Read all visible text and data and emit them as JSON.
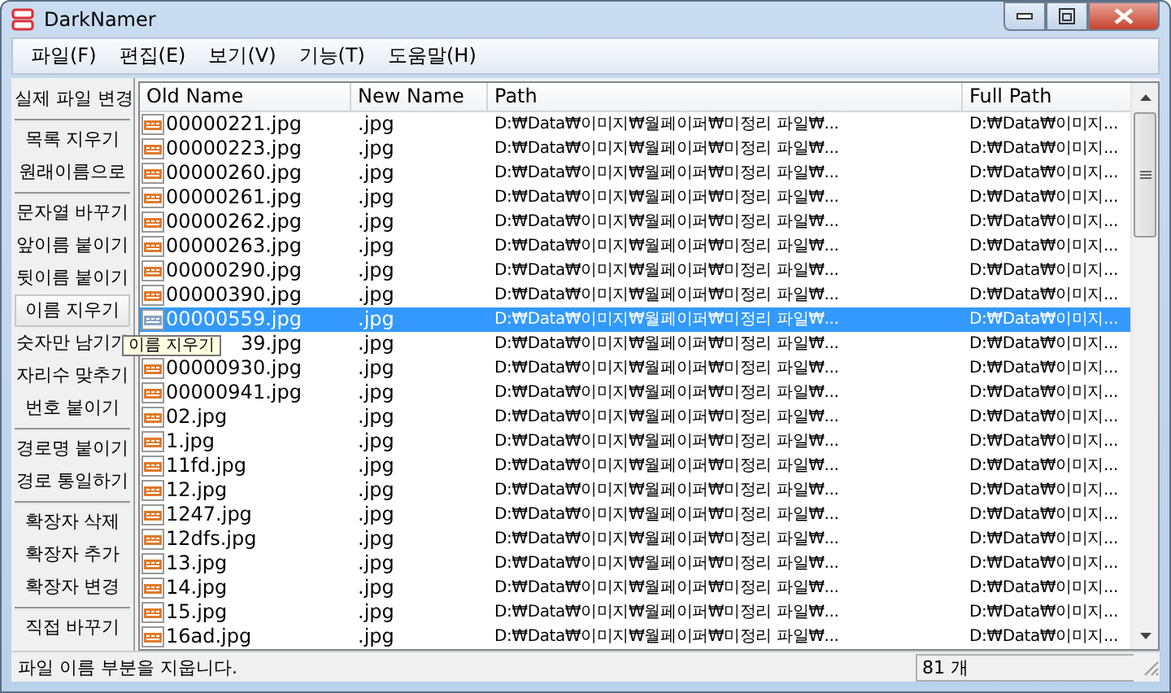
{
  "window": {
    "title": "DarkNamer"
  },
  "menu": [
    "파일(F)",
    "편집(E)",
    "보기(V)",
    "기능(T)",
    "도움말(H)"
  ],
  "sidebar": {
    "groups": [
      {
        "buttons": [
          {
            "label": "실제 파일 변경",
            "hovered": false
          }
        ]
      },
      {
        "buttons": [
          {
            "label": "목록 지우기",
            "hovered": false
          },
          {
            "label": "원래이름으로",
            "hovered": false
          }
        ]
      },
      {
        "buttons": [
          {
            "label": "문자열 바꾸기",
            "hovered": false
          },
          {
            "label": "앞이름 붙이기",
            "hovered": false
          },
          {
            "label": "뒷이름 붙이기",
            "hovered": false
          },
          {
            "label": "이름 지우기",
            "hovered": true
          },
          {
            "label": "숫자만 남기기",
            "hovered": false
          },
          {
            "label": "자리수 맞추기",
            "hovered": false
          },
          {
            "label": "번호 붙이기",
            "hovered": false
          }
        ]
      },
      {
        "buttons": [
          {
            "label": "경로명 붙이기",
            "hovered": false
          },
          {
            "label": "경로 통일하기",
            "hovered": false
          }
        ]
      },
      {
        "buttons": [
          {
            "label": "확장자 삭제",
            "hovered": false
          },
          {
            "label": "확장자 추가",
            "hovered": false
          },
          {
            "label": "확장자 변경",
            "hovered": false
          }
        ]
      },
      {
        "buttons": [
          {
            "label": "직접 바꾸기",
            "hovered": false
          }
        ]
      }
    ]
  },
  "table": {
    "columns": [
      "Old Name",
      "New Name",
      "Path",
      "Full Path"
    ],
    "rows": [
      {
        "old_name": "00000221.jpg",
        "new_name": ".jpg",
        "path": "D:₩Data₩이미지₩월페이퍼₩미정리 파일₩...",
        "full_path": "D:₩Data₩이미지...",
        "selected": false
      },
      {
        "old_name": "00000223.jpg",
        "new_name": ".jpg",
        "path": "D:₩Data₩이미지₩월페이퍼₩미정리 파일₩...",
        "full_path": "D:₩Data₩이미지...",
        "selected": false
      },
      {
        "old_name": "00000260.jpg",
        "new_name": ".jpg",
        "path": "D:₩Data₩이미지₩월페이퍼₩미정리 파일₩...",
        "full_path": "D:₩Data₩이미지...",
        "selected": false
      },
      {
        "old_name": "00000261.jpg",
        "new_name": ".jpg",
        "path": "D:₩Data₩이미지₩월페이퍼₩미정리 파일₩...",
        "full_path": "D:₩Data₩이미지...",
        "selected": false
      },
      {
        "old_name": "00000262.jpg",
        "new_name": ".jpg",
        "path": "D:₩Data₩이미지₩월페이퍼₩미정리 파일₩...",
        "full_path": "D:₩Data₩이미지...",
        "selected": false
      },
      {
        "old_name": "00000263.jpg",
        "new_name": ".jpg",
        "path": "D:₩Data₩이미지₩월페이퍼₩미정리 파일₩...",
        "full_path": "D:₩Data₩이미지...",
        "selected": false
      },
      {
        "old_name": "00000290.jpg",
        "new_name": ".jpg",
        "path": "D:₩Data₩이미지₩월페이퍼₩미정리 파일₩...",
        "full_path": "D:₩Data₩이미지...",
        "selected": false
      },
      {
        "old_name": "00000390.jpg",
        "new_name": ".jpg",
        "path": "D:₩Data₩이미지₩월페이퍼₩미정리 파일₩...",
        "full_path": "D:₩Data₩이미지...",
        "selected": false
      },
      {
        "old_name": "00000559.jpg",
        "new_name": ".jpg",
        "path": "D:₩Data₩이미지₩월페이퍼₩미정리 파일₩...",
        "full_path": "D:₩Data₩이미지...",
        "selected": true
      },
      {
        "old_name": "39.jpg",
        "new_name": ".jpg",
        "path": "D:₩Data₩이미지₩월페이퍼₩미정리 파일₩...",
        "full_path": "D:₩Data₩이미지...",
        "selected": false,
        "covered": true
      },
      {
        "old_name": "00000930.jpg",
        "new_name": ".jpg",
        "path": "D:₩Data₩이미지₩월페이퍼₩미정리 파일₩...",
        "full_path": "D:₩Data₩이미지...",
        "selected": false
      },
      {
        "old_name": "00000941.jpg",
        "new_name": ".jpg",
        "path": "D:₩Data₩이미지₩월페이퍼₩미정리 파일₩...",
        "full_path": "D:₩Data₩이미지...",
        "selected": false
      },
      {
        "old_name": "02.jpg",
        "new_name": ".jpg",
        "path": "D:₩Data₩이미지₩월페이퍼₩미정리 파일₩...",
        "full_path": "D:₩Data₩이미지...",
        "selected": false
      },
      {
        "old_name": "1.jpg",
        "new_name": ".jpg",
        "path": "D:₩Data₩이미지₩월페이퍼₩미정리 파일₩...",
        "full_path": "D:₩Data₩이미지...",
        "selected": false
      },
      {
        "old_name": "11fd.jpg",
        "new_name": ".jpg",
        "path": "D:₩Data₩이미지₩월페이퍼₩미정리 파일₩...",
        "full_path": "D:₩Data₩이미지...",
        "selected": false
      },
      {
        "old_name": "12.jpg",
        "new_name": ".jpg",
        "path": "D:₩Data₩이미지₩월페이퍼₩미정리 파일₩...",
        "full_path": "D:₩Data₩이미지...",
        "selected": false
      },
      {
        "old_name": "1247.jpg",
        "new_name": ".jpg",
        "path": "D:₩Data₩이미지₩월페이퍼₩미정리 파일₩...",
        "full_path": "D:₩Data₩이미지...",
        "selected": false
      },
      {
        "old_name": "12dfs.jpg",
        "new_name": ".jpg",
        "path": "D:₩Data₩이미지₩월페이퍼₩미정리 파일₩...",
        "full_path": "D:₩Data₩이미지...",
        "selected": false
      },
      {
        "old_name": "13.jpg",
        "new_name": ".jpg",
        "path": "D:₩Data₩이미지₩월페이퍼₩미정리 파일₩...",
        "full_path": "D:₩Data₩이미지...",
        "selected": false
      },
      {
        "old_name": "14.jpg",
        "new_name": ".jpg",
        "path": "D:₩Data₩이미지₩월페이퍼₩미정리 파일₩...",
        "full_path": "D:₩Data₩이미지...",
        "selected": false
      },
      {
        "old_name": "15.jpg",
        "new_name": ".jpg",
        "path": "D:₩Data₩이미지₩월페이퍼₩미정리 파일₩...",
        "full_path": "D:₩Data₩이미지...",
        "selected": false
      },
      {
        "old_name": "16ad.jpg",
        "new_name": ".jpg",
        "path": "D:₩Data₩이미지₩월페이퍼₩미정리 파일₩...",
        "full_path": "D:₩Data₩이미지...",
        "selected": false
      }
    ]
  },
  "tooltip": "이름 지우기",
  "status_bar": {
    "message": "파일 이름 부분을 지웁니다.",
    "count": "81 개"
  }
}
